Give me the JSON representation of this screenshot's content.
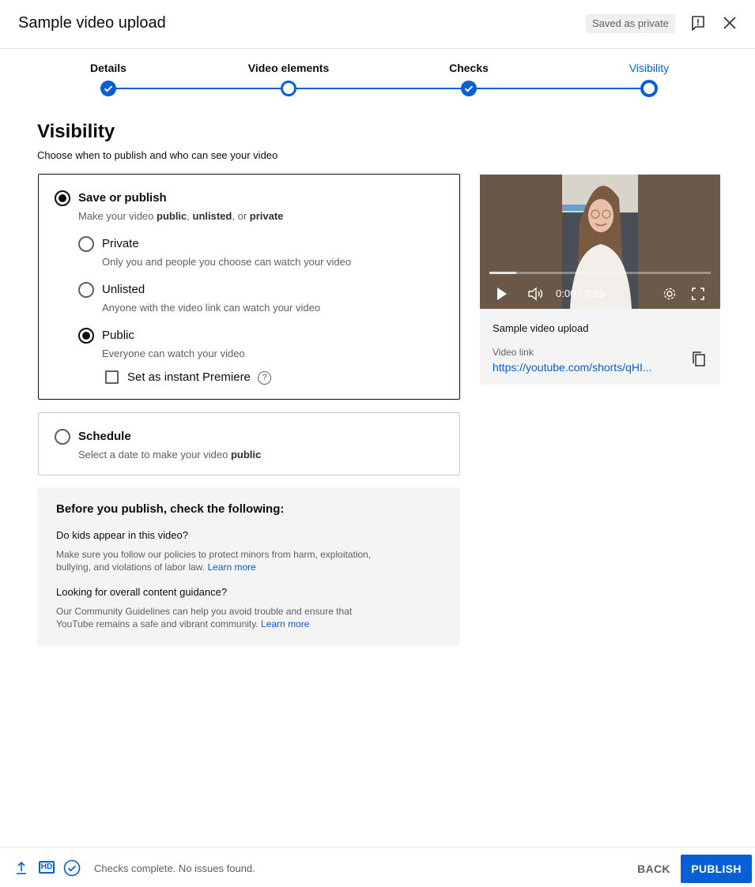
{
  "header": {
    "title": "Sample video upload",
    "saved_badge": "Saved as private",
    "feedback_icon": "feedback-icon",
    "close_icon": "close-icon"
  },
  "stepper": {
    "steps": [
      {
        "label": "Details",
        "state": "complete"
      },
      {
        "label": "Video elements",
        "state": "visited"
      },
      {
        "label": "Checks",
        "state": "complete"
      },
      {
        "label": "Visibility",
        "state": "current"
      }
    ],
    "accent": "#065fd4"
  },
  "visibility": {
    "title": "Visibility",
    "subtitle": "Choose when to publish and who can see your video",
    "save_or_publish": {
      "label": "Save or publish",
      "desc_prefix": "Make your video ",
      "desc_public": "public",
      "desc_sep1": ", ",
      "desc_unlisted": "unlisted",
      "desc_sep2": ", or ",
      "desc_private": "private",
      "selected": true
    },
    "options": [
      {
        "label": "Private",
        "desc": "Only you and people you choose can watch your video",
        "selected": false
      },
      {
        "label": "Unlisted",
        "desc": "Anyone with the video link can watch your video",
        "selected": false
      },
      {
        "label": "Public",
        "desc": "Everyone can watch your video",
        "selected": true
      }
    ],
    "premiere": {
      "label": "Set as instant Premiere",
      "checked": false,
      "help_glyph": "?"
    },
    "schedule": {
      "label": "Schedule",
      "desc_prefix": "Select a date to make your video ",
      "desc_bold": "public",
      "selected": false
    }
  },
  "checklist": {
    "title": "Before you publish, check the following:",
    "items": [
      {
        "question": "Do kids appear in this video?",
        "line1": "Make sure you follow our policies to protect minors from harm, exploitation,",
        "line2": "bullying, and violations of labor law.",
        "link": "Learn more"
      },
      {
        "question": "Looking for overall content guidance?",
        "line1": "Our Community Guidelines can help you avoid trouble and ensure that",
        "line2": "YouTube remains a safe and vibrant community.",
        "link": "Learn more"
      }
    ]
  },
  "preview": {
    "time": "0:00 / 0:59",
    "progress_fraction": 0.0,
    "title": "Sample video upload",
    "link_label": "Video link",
    "link": "https://youtube.com/shorts/qHI..."
  },
  "footer": {
    "status": "Checks complete. No issues found.",
    "hd_label": "HD",
    "back": "BACK",
    "publish": "PUBLISH"
  }
}
